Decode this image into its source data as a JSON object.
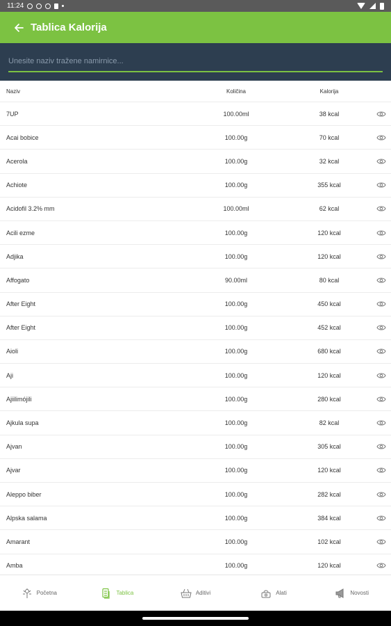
{
  "status_bar": {
    "time": "11:24"
  },
  "app_bar": {
    "title": "Tablica Kalorija"
  },
  "search": {
    "placeholder": "Unesite naziv tražene namirnice..."
  },
  "table": {
    "headers": {
      "name": "Naziv",
      "quantity": "Količina",
      "calories": "Kalorija"
    },
    "rows": [
      {
        "name": "7UP",
        "quantity": "100.00ml",
        "calories": "38 kcal"
      },
      {
        "name": "Acai bobice",
        "quantity": "100.00g",
        "calories": "70 kcal"
      },
      {
        "name": "Acerola",
        "quantity": "100.00g",
        "calories": "32 kcal"
      },
      {
        "name": "Achiote",
        "quantity": "100.00g",
        "calories": "355 kcal"
      },
      {
        "name": "Acidofil 3.2% mm",
        "quantity": "100.00ml",
        "calories": "62 kcal"
      },
      {
        "name": "Acili ezme",
        "quantity": "100.00g",
        "calories": "120 kcal"
      },
      {
        "name": "Adjika",
        "quantity": "100.00g",
        "calories": "120 kcal"
      },
      {
        "name": "Affogato",
        "quantity": "90.00ml",
        "calories": "80 kcal"
      },
      {
        "name": "After Eight",
        "quantity": "100.00g",
        "calories": "450 kcal"
      },
      {
        "name": "After Eight",
        "quantity": "100.00g",
        "calories": "452 kcal"
      },
      {
        "name": "Aioli",
        "quantity": "100.00g",
        "calories": "680 kcal"
      },
      {
        "name": "Aji",
        "quantity": "100.00g",
        "calories": "120 kcal"
      },
      {
        "name": "Ajiilimójili",
        "quantity": "100.00g",
        "calories": "280 kcal"
      },
      {
        "name": "Ajkula supa",
        "quantity": "100.00g",
        "calories": "82 kcal"
      },
      {
        "name": "Ajvan",
        "quantity": "100.00g",
        "calories": "305 kcal"
      },
      {
        "name": "Ajvar",
        "quantity": "100.00g",
        "calories": "120 kcal"
      },
      {
        "name": "Aleppo biber",
        "quantity": "100.00g",
        "calories": "282 kcal"
      },
      {
        "name": "Alpska salama",
        "quantity": "100.00g",
        "calories": "384 kcal"
      },
      {
        "name": "Amarant",
        "quantity": "100.00g",
        "calories": "102 kcal"
      },
      {
        "name": "Amba",
        "quantity": "100.00g",
        "calories": "120 kcal"
      }
    ]
  },
  "bottom_nav": {
    "items": [
      {
        "label": "Početna",
        "icon": "sprout-icon",
        "active": false
      },
      {
        "label": "Tablica",
        "icon": "table-icon",
        "active": true
      },
      {
        "label": "Aditivi",
        "icon": "basket-icon",
        "active": false
      },
      {
        "label": "Alati",
        "icon": "scale-icon",
        "active": false
      },
      {
        "label": "Novosti",
        "icon": "megaphone-icon",
        "active": false
      }
    ]
  },
  "colors": {
    "accent": "#7cc242",
    "header_dark": "#2d3e50",
    "status_bar": "#5a5a5a"
  }
}
